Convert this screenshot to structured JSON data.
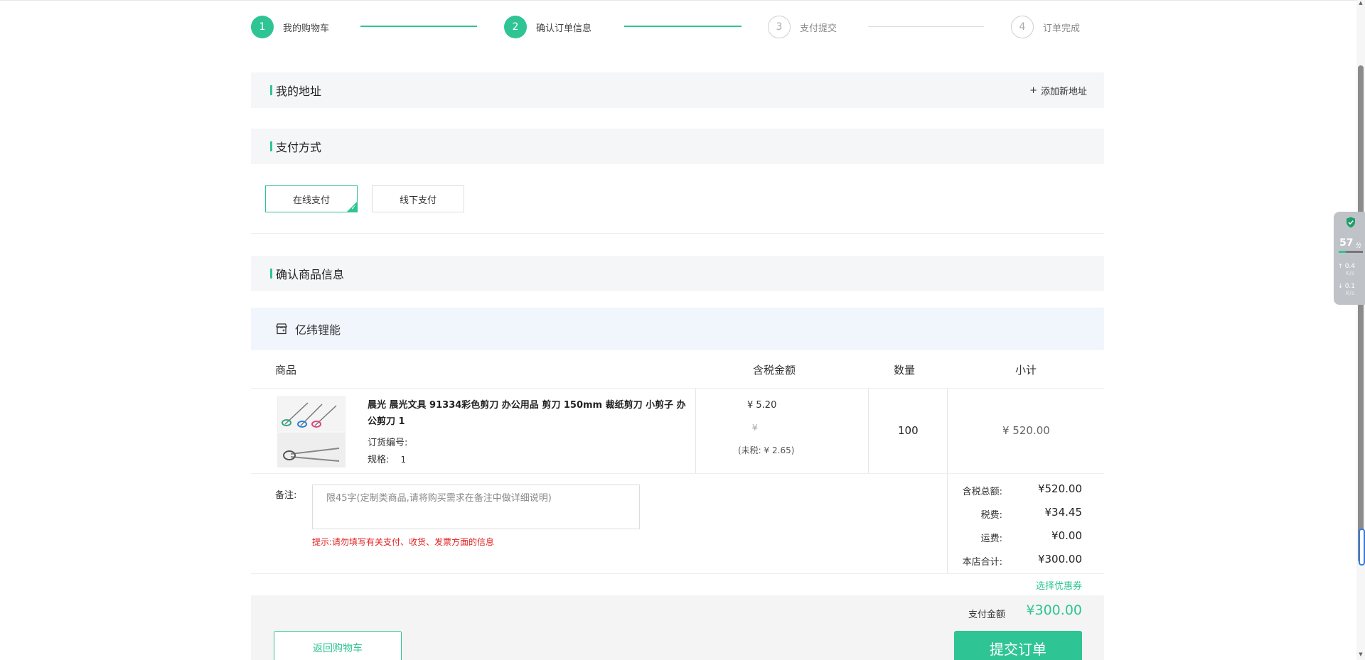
{
  "steps": [
    {
      "num": "1",
      "label": "我的购物车"
    },
    {
      "num": "2",
      "label": "确认订单信息"
    },
    {
      "num": "3",
      "label": "支付提交"
    },
    {
      "num": "4",
      "label": "订单完成"
    }
  ],
  "address": {
    "title": "我的地址",
    "add_label": "添加新地址",
    "add_prefix": "+"
  },
  "payment": {
    "title": "支付方式",
    "options": [
      "在线支付",
      "线下支付"
    ],
    "selected": "在线支付",
    "check": "✓"
  },
  "goods_section": {
    "title": "确认商品信息"
  },
  "store": {
    "name": "亿纬锂能"
  },
  "table": {
    "headers": {
      "product": "商品",
      "price": "含税金额",
      "qty": "数量",
      "subtotal": "小计"
    },
    "row": {
      "title": "晨光 晨光文具 91334彩色剪刀 办公用品 剪刀 150mm 裁纸剪刀 小剪子 办公剪刀 1",
      "order_no_label": "订货编号:",
      "order_no_value": "",
      "spec_label": "规格:",
      "spec_value": "1",
      "price": "¥ 5.20",
      "price_strike": "¥",
      "price_notax": "(未税: ¥ 2.65)",
      "qty": "100",
      "subtotal": "¥ 520.00"
    }
  },
  "remark": {
    "label": "备注:",
    "placeholder": "限45字(定制类商品,请将购买需求在备注中做详细说明)",
    "hint": "提示:请勿填写有关支付、收货、发票方面的信息"
  },
  "summary": [
    {
      "label": "含税总额:",
      "value": "¥520.00"
    },
    {
      "label": "税费:",
      "value": "¥34.45"
    },
    {
      "label": "运费:",
      "value": "¥0.00"
    },
    {
      "label": "本店合计:",
      "value": "¥300.00"
    }
  ],
  "coupon_label": "选择优惠券",
  "footer": {
    "pay_amount_label": "支付金额",
    "pay_amount_value": "¥300.00",
    "back_label": "返回购物车",
    "submit_label": "提交订单"
  },
  "widget": {
    "score": "57",
    "score_unit": "分",
    "up_value": "0.4",
    "up_unit": "K/s",
    "down_value": "0.1",
    "down_unit": "K/s"
  },
  "colors": {
    "accent": "#2fc494",
    "warning": "#e02020",
    "store_bar": "#f1f6fd"
  }
}
